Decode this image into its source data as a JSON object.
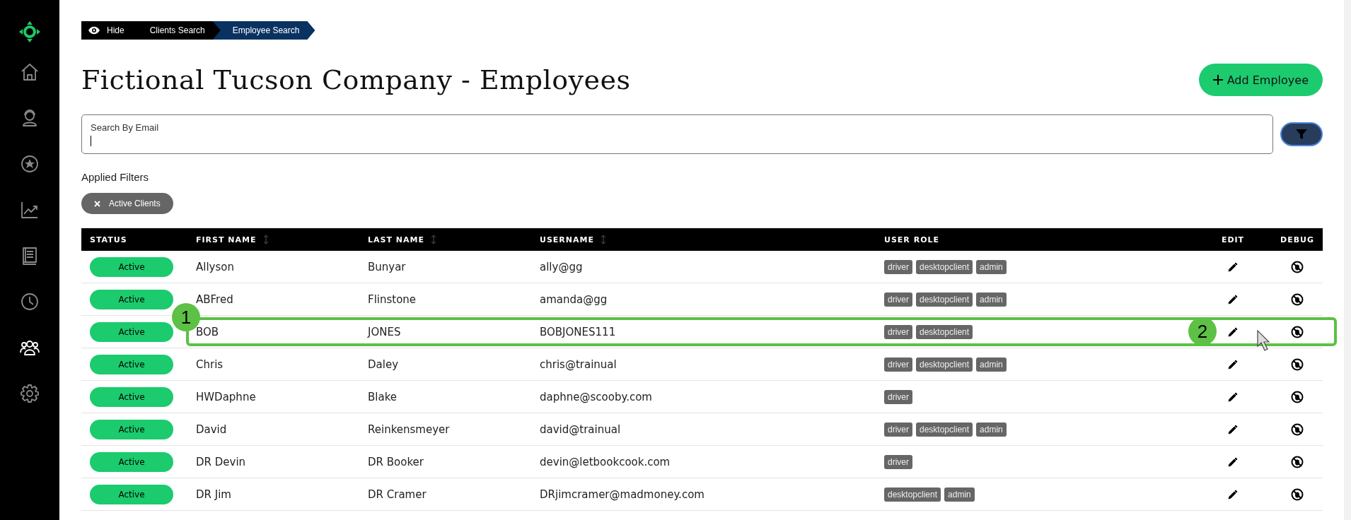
{
  "sidebar": {
    "items": [
      {
        "kind": "home",
        "selected": false
      },
      {
        "kind": "support",
        "selected": false
      },
      {
        "kind": "star",
        "selected": false
      },
      {
        "kind": "chart",
        "selected": false
      },
      {
        "kind": "book",
        "selected": false
      },
      {
        "kind": "clock",
        "selected": false
      },
      {
        "kind": "people",
        "selected": true
      },
      {
        "kind": "settings",
        "selected": false
      }
    ]
  },
  "breadcrumb": {
    "hide_label": "Hide",
    "items": [
      {
        "label": "Clients Search",
        "selected": false
      },
      {
        "label": "Employee Search",
        "selected": true
      }
    ]
  },
  "title": "Fictional Tucson Company - Employees",
  "add_button": "Add Employee",
  "search": {
    "label": "Search By Email"
  },
  "filters": {
    "heading": "Applied Filters",
    "chips": [
      {
        "label": "Active Clients"
      }
    ]
  },
  "table": {
    "columns": [
      {
        "label": "STATUS",
        "sortable": false
      },
      {
        "label": "FIRST NAME",
        "sortable": true
      },
      {
        "label": "LAST NAME",
        "sortable": true
      },
      {
        "label": "USERNAME",
        "sortable": true
      },
      {
        "label": "USER ROLE",
        "sortable": false
      },
      {
        "label": "EDIT",
        "sortable": false
      },
      {
        "label": "DEBUG",
        "sortable": false
      }
    ],
    "rows": [
      {
        "status": "Active",
        "first_name": "Allyson",
        "last_name": "Bunyar",
        "username": "ally@gg",
        "roles": [
          "driver",
          "desktopclient",
          "admin"
        ]
      },
      {
        "status": "Active",
        "first_name": "ABFred",
        "last_name": "Flinstone",
        "username": "amanda@gg",
        "roles": [
          "driver",
          "desktopclient",
          "admin"
        ]
      },
      {
        "status": "Active",
        "first_name": "BOB",
        "last_name": "JONES",
        "username": "BOBJONES111",
        "roles": [
          "driver",
          "desktopclient"
        ],
        "annotation": {
          "row_number": "1",
          "edit_number": "2"
        }
      },
      {
        "status": "Active",
        "first_name": "Chris",
        "last_name": "Daley",
        "username": "chris@trainual",
        "roles": [
          "driver",
          "desktopclient",
          "admin"
        ]
      },
      {
        "status": "Active",
        "first_name": "HWDaphne",
        "last_name": "Blake",
        "username": "daphne@scooby.com",
        "roles": [
          "driver"
        ]
      },
      {
        "status": "Active",
        "first_name": "David",
        "last_name": "Reinkensmeyer",
        "username": "david@trainual",
        "roles": [
          "driver",
          "desktopclient",
          "admin"
        ]
      },
      {
        "status": "Active",
        "first_name": "DR Devin",
        "last_name": "DR Booker",
        "username": "devin@letbookcook.com",
        "roles": [
          "driver"
        ]
      },
      {
        "status": "Active",
        "first_name": "DR Jim",
        "last_name": "DR Cramer",
        "username": "DRjimcramer@madmoney.com",
        "roles": [
          "desktopclient",
          "admin"
        ]
      }
    ]
  }
}
